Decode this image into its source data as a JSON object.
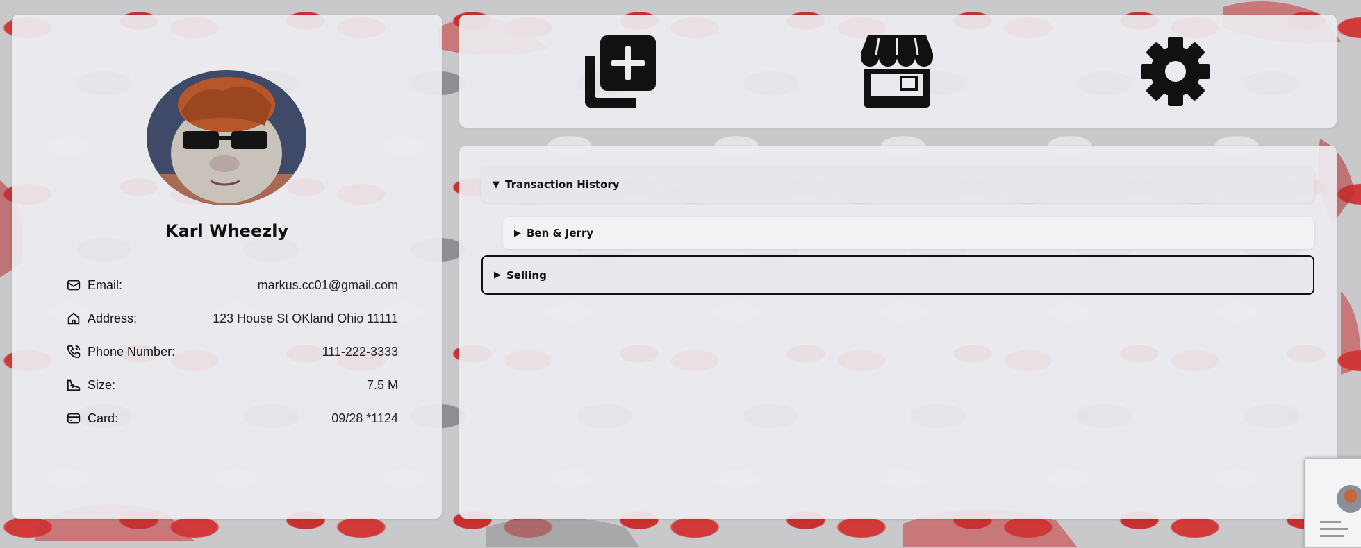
{
  "profile": {
    "name": "Karl Wheezly",
    "fields": [
      {
        "icon": "envelope-icon",
        "label": "Email:",
        "value": "markus.cc01@gmail.com"
      },
      {
        "icon": "house-icon",
        "label": "Address:",
        "value": "123 House St OKland Ohio 11111"
      },
      {
        "icon": "phone-icon",
        "label": "Phone Number:",
        "value": "111-222-3333"
      },
      {
        "icon": "shoe-icon",
        "label": "Size:",
        "value": "7.5 M"
      },
      {
        "icon": "credit-card-icon",
        "label": "Card:",
        "value": "09/28 *1124"
      }
    ]
  },
  "actions": [
    {
      "icon": "add-listing-icon"
    },
    {
      "icon": "storefront-icon"
    },
    {
      "icon": "gear-icon"
    }
  ],
  "history": {
    "transaction_history_label": "Transaction History",
    "transaction_history_state": "open",
    "entries": [
      {
        "label": "Ben & Jerry",
        "state": "closed"
      }
    ],
    "selling_label": "Selling",
    "selling_state": "closed"
  },
  "carets": {
    "open": "▼",
    "closed": "▶"
  },
  "colors": {
    "panel_bg": "#ececf0",
    "icon": "#111111",
    "sneaker_red": "#d23a3a",
    "sneaker_gray": "#8e8e93"
  }
}
